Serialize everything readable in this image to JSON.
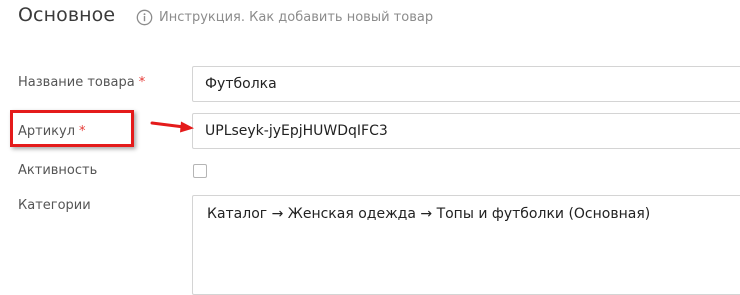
{
  "section": {
    "title": "Основное",
    "help_icon": "info-circle-icon",
    "help_text": "Инструкция. Как добавить новый товар"
  },
  "form": {
    "name": {
      "label": "Название товара",
      "required_mark": "*",
      "value": "Футболка"
    },
    "sku": {
      "label": "Артикул",
      "required_mark": "*",
      "value": "UPLseyk-jyEpjHUWDqIFC3"
    },
    "active": {
      "label": "Активность",
      "checked": false
    },
    "categories": {
      "label": "Категории",
      "value": "Каталог → Женская одежда → Топы и футболки (Основная)"
    }
  },
  "annotation": {
    "highlight_color": "#e41b1b",
    "arrow_icon": "red-arrow-right-icon"
  }
}
